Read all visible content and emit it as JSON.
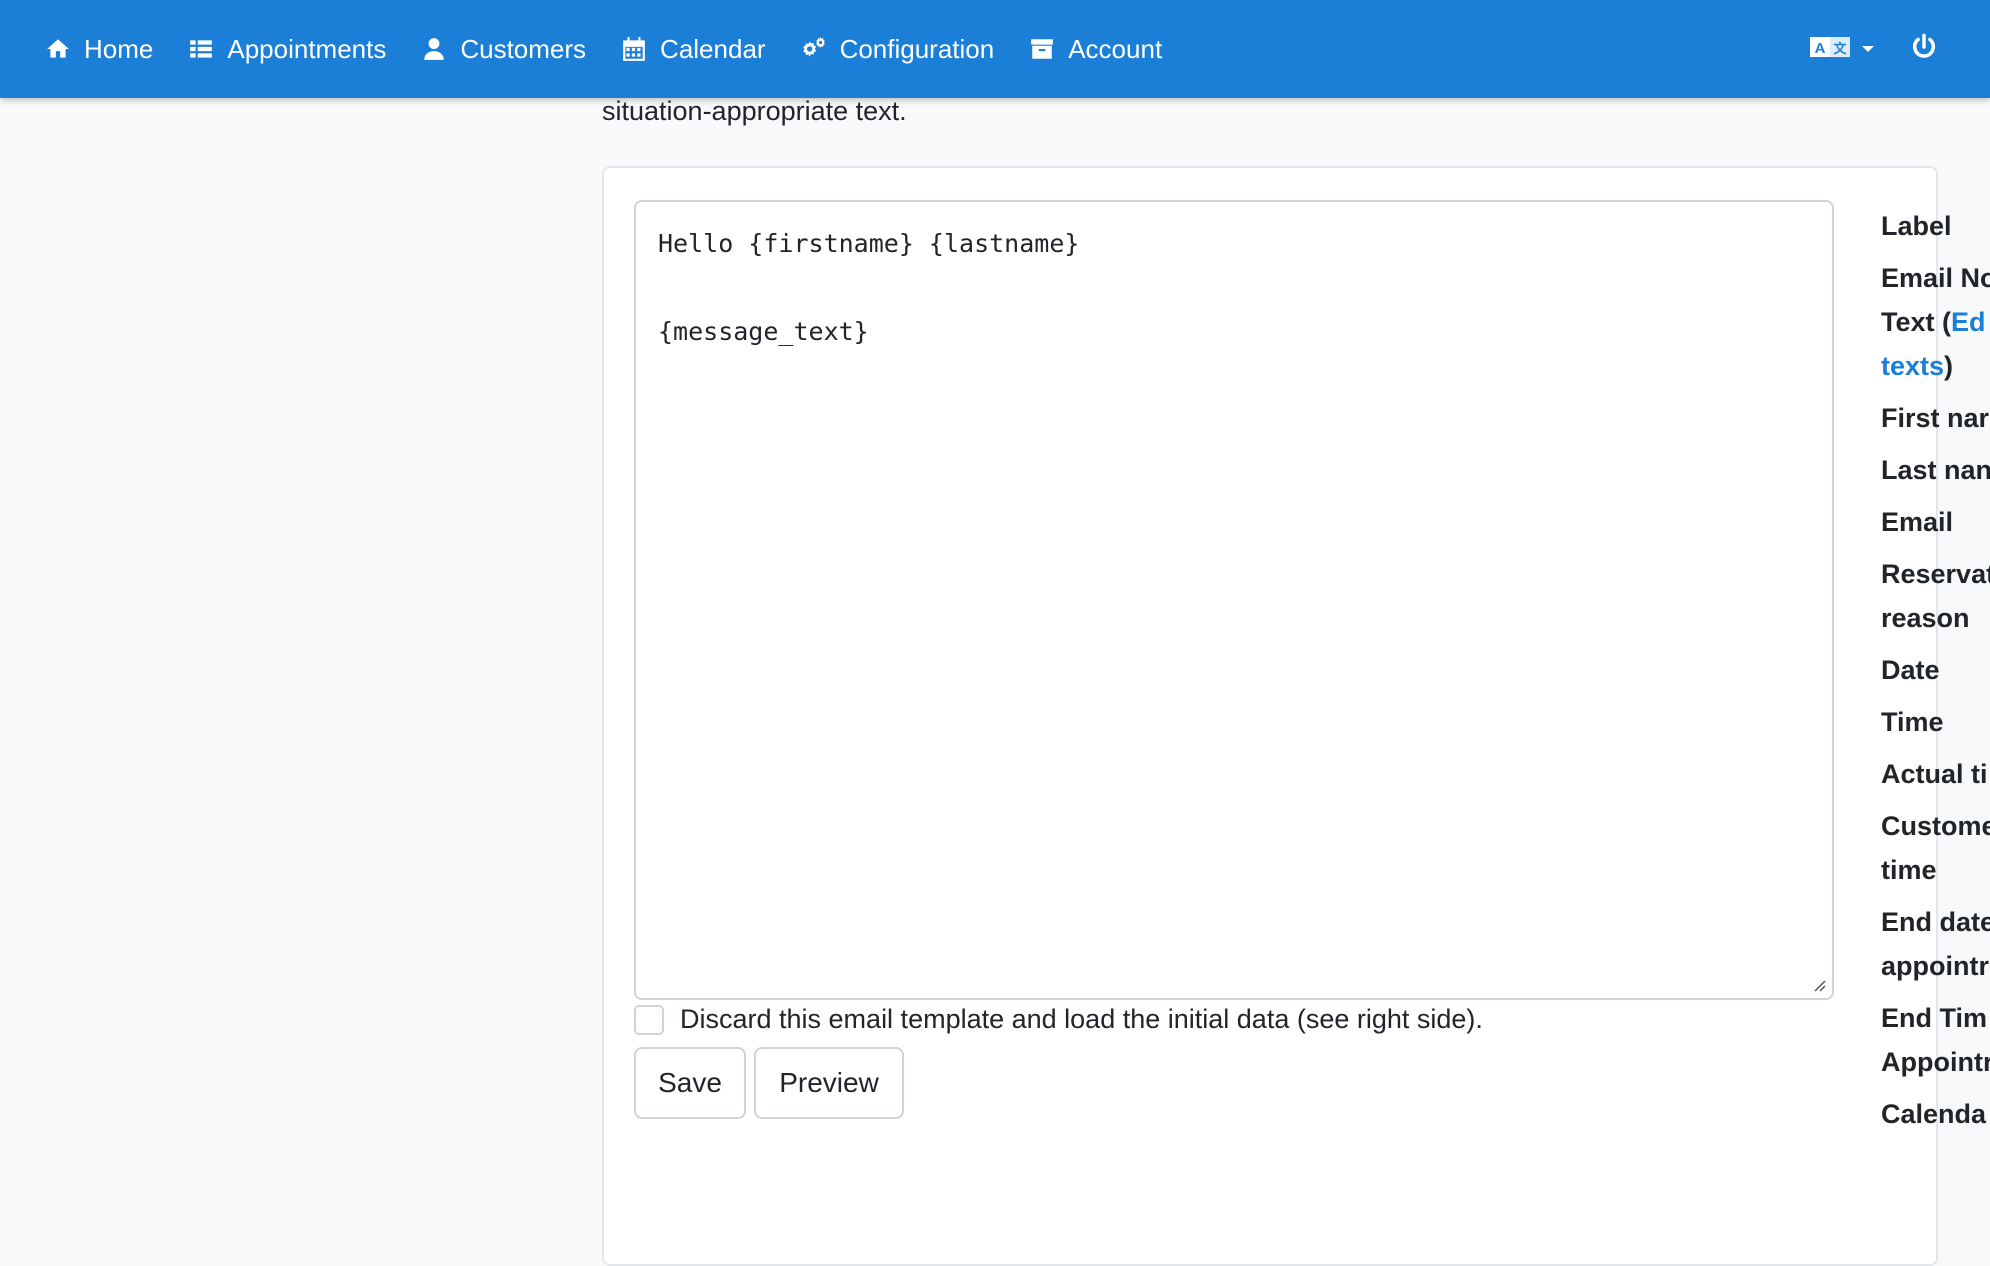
{
  "nav": {
    "items": [
      {
        "label": "Home",
        "icon": "home-icon"
      },
      {
        "label": "Appointments",
        "icon": "list-icon"
      },
      {
        "label": "Customers",
        "icon": "user-icon"
      },
      {
        "label": "Calendar",
        "icon": "calendar-icon"
      },
      {
        "label": "Configuration",
        "icon": "gears-icon"
      },
      {
        "label": "Account",
        "icon": "archive-icon"
      }
    ],
    "language_icon": "language-icon",
    "power_icon": "power-icon",
    "bar_color": "#1b7fd8"
  },
  "intro": {
    "text": "situation-appropriate text."
  },
  "editor": {
    "content": "Hello {firstname} {lastname}\n\n{message_text}"
  },
  "discard": {
    "label": "Discard this email template and load the initial data (see right side).",
    "checked": false
  },
  "buttons": {
    "save": "Save",
    "preview": "Preview"
  },
  "labels": {
    "label": "Label",
    "email_notification_a": "Email Notificat",
    "email_notification_b": "Text (",
    "edit_link_a": "Ed",
    "edit_link_b": "texts",
    "email_notification_close": ")",
    "first_name": "First nar",
    "last_name": "Last nan",
    "email": "Email",
    "reservation_reason_a": "Reservat",
    "reservation_reason_b": "reason",
    "date": "Date",
    "time": "Time",
    "actual_time": "Actual ti",
    "customer_time_a": "Custome",
    "customer_time_b": "time",
    "end_date_a": "End date",
    "end_date_b": "appointr",
    "end_time_a": "End Tim",
    "end_time_b": "Appointr",
    "calendar": "Calenda"
  }
}
